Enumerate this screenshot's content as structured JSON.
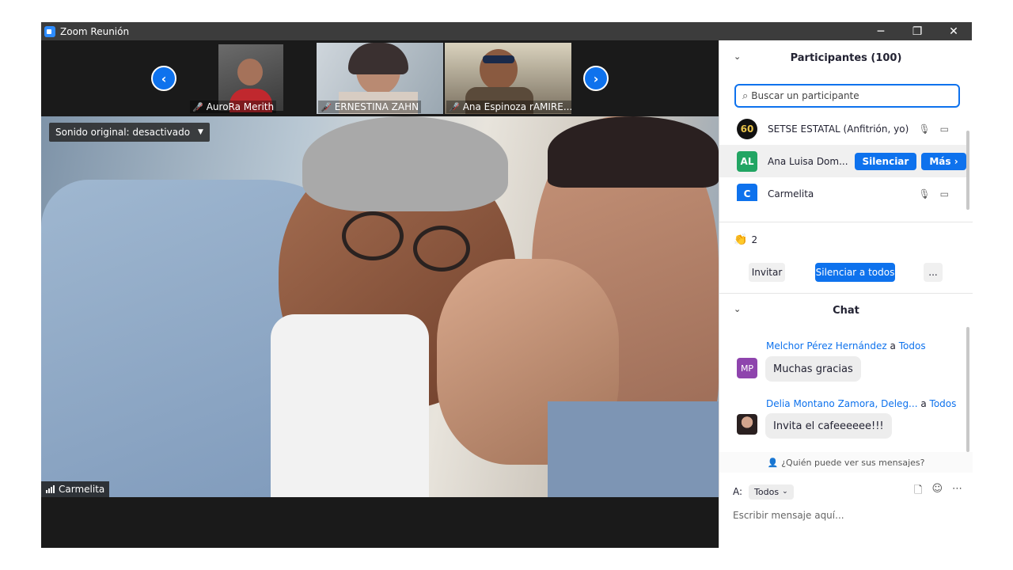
{
  "window": {
    "title": "Zoom Reunión",
    "controls": {
      "minimize": "─",
      "restore": "❐",
      "close": "✕"
    }
  },
  "gallery": {
    "prev_icon": "chevron-left-icon",
    "next_icon": "chevron-right-icon",
    "thumbnails": [
      {
        "name": "AuroRa Merith",
        "muted": true
      },
      {
        "name": "ERNESTINA ZAHN",
        "muted": true
      },
      {
        "name": "Ana Espinoza rAMIRE...",
        "muted": true
      }
    ]
  },
  "main_video": {
    "original_sound": "Sonido original: desactivado",
    "speaker_name": "Carmelita"
  },
  "participants": {
    "header": "Participantes (100)",
    "search_placeholder": "Buscar un participante",
    "rows": [
      {
        "avatar_text": "60",
        "avatar_color": "#111111",
        "name": "SETSE ESTATAL (Anfitrión, yo)"
      },
      {
        "avatar_text": "AL",
        "avatar_color": "#22a563",
        "name": "Ana Luisa Dom...",
        "mute_button": "Silenciar",
        "more_button": "Más ›"
      },
      {
        "avatar_text": "C",
        "avatar_color": "#0e72ed",
        "name": "Carmelita"
      }
    ],
    "reaction_count": "2",
    "invite_button": "Invitar",
    "mute_all_button": "Silenciar a todos",
    "more_button": "..."
  },
  "chat": {
    "header": "Chat",
    "messages": [
      {
        "sender": "Melchor Pérez Hernández",
        "to_word": "a",
        "recipient": "Todos",
        "avatar_text": "MP",
        "avatar_color": "#8e44ad",
        "text": "Muchas gracias"
      },
      {
        "sender": "Delia Montano Zamora, Deleg...",
        "to_word": "a",
        "recipient": "Todos",
        "avatar_text": "",
        "avatar_color": "#a0786a",
        "text": "Invita el cafeeeeee!!!"
      }
    ],
    "who_can_see": "¿Quién puede ver sus mensajes?",
    "to_label": "A:",
    "to_value": "Todos",
    "input_placeholder": "Escribir mensaje aquí..."
  },
  "colors": {
    "accent": "#0e72ed",
    "muted_red": "#e02828"
  }
}
